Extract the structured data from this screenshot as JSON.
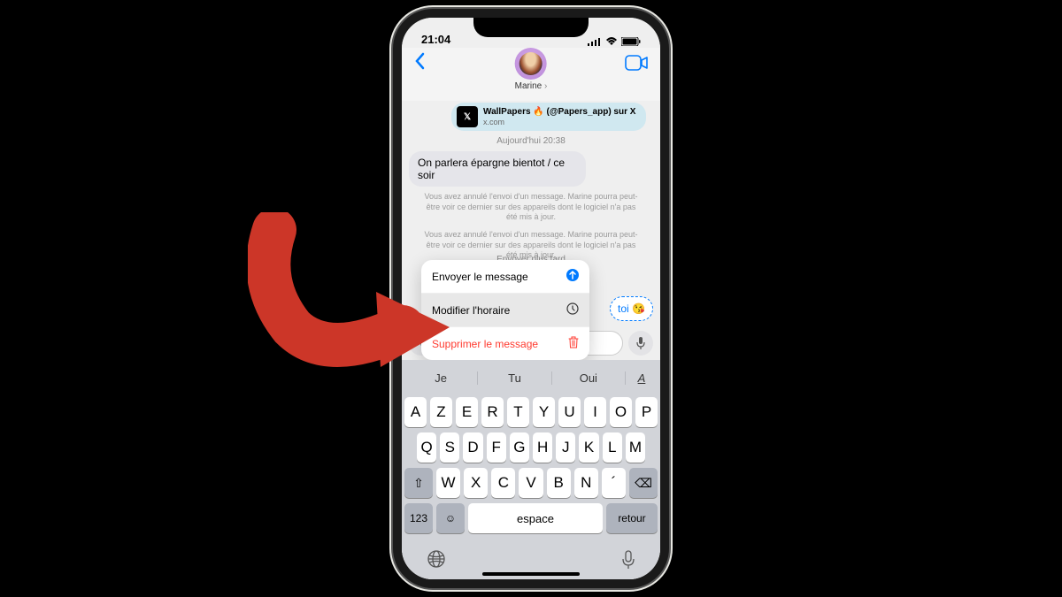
{
  "status": {
    "time": "21:04"
  },
  "contact": {
    "name": "Marine"
  },
  "link": {
    "title": "WallPapers 🔥 (@Papers_app) sur X",
    "domain": "x.com",
    "badge": "𝕏"
  },
  "conversation": {
    "timestamp": "Aujourd'hui 20:38",
    "incoming": "On parlera épargne bientot / ce soir",
    "system": "Vous avez annulé l'envoi d'un message. Marine pourra peut-être voir ce dernier sur des appareils dont le logiciel n'a pas été mis à jour.",
    "scheduled_label": "Envoyer plus tard",
    "scheduled_bubble": "toi 😘"
  },
  "menu": {
    "send": "Envoyer le message",
    "edit": "Modifier l'horaire",
    "delete": "Supprimer le message"
  },
  "keyboard": {
    "suggestions": [
      "Je",
      "Tu",
      "Oui"
    ],
    "row1": [
      "A",
      "Z",
      "E",
      "R",
      "T",
      "Y",
      "U",
      "I",
      "O",
      "P"
    ],
    "row2": [
      "Q",
      "S",
      "D",
      "F",
      "G",
      "H",
      "J",
      "K",
      "L",
      "M"
    ],
    "row3": [
      "W",
      "X",
      "C",
      "V",
      "B",
      "N",
      "´"
    ],
    "shift": "⇧",
    "backspace": "⌫",
    "numeric": "123",
    "emoji": "☺",
    "space": "espace",
    "return": "retour",
    "globe": "🌐",
    "mic": "🎤"
  }
}
